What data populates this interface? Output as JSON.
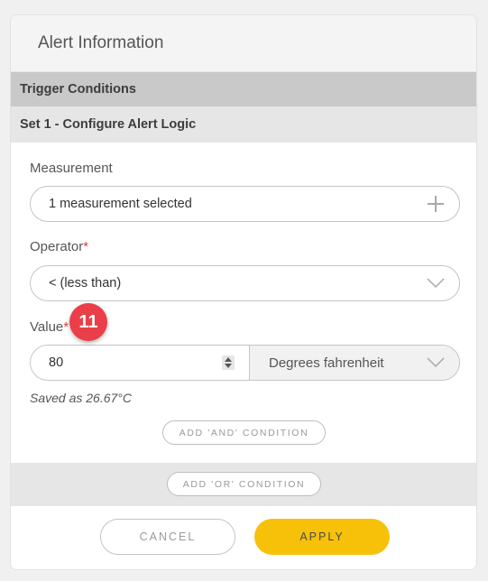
{
  "header": {
    "title": "Alert Information"
  },
  "sections": {
    "trigger_conditions": "Trigger Conditions",
    "set_title": "Set 1 - Configure Alert Logic"
  },
  "measurement": {
    "label": "Measurement",
    "value": "1 measurement selected",
    "icon": "plus-icon"
  },
  "operator": {
    "label": "Operator",
    "required_mark": "*",
    "selected": "< (less than)",
    "icon": "chevron-down-icon"
  },
  "value": {
    "label": "Value",
    "required_mark": "*",
    "input_value": "80",
    "unit": "Degrees fahrenheit",
    "saved_as": "Saved as 26.67°C"
  },
  "buttons": {
    "add_and": "ADD 'AND' CONDITION",
    "add_or": "ADD 'OR' CONDITION",
    "cancel": "CANCEL",
    "apply": "APPLY"
  },
  "badge": {
    "number": "11"
  },
  "colors": {
    "apply": "#f7c10a",
    "badge": "#ea3f48",
    "required": "#e03b3b",
    "section_bar": "#c9c9c9",
    "subsection_bar": "#e6e6e6"
  }
}
